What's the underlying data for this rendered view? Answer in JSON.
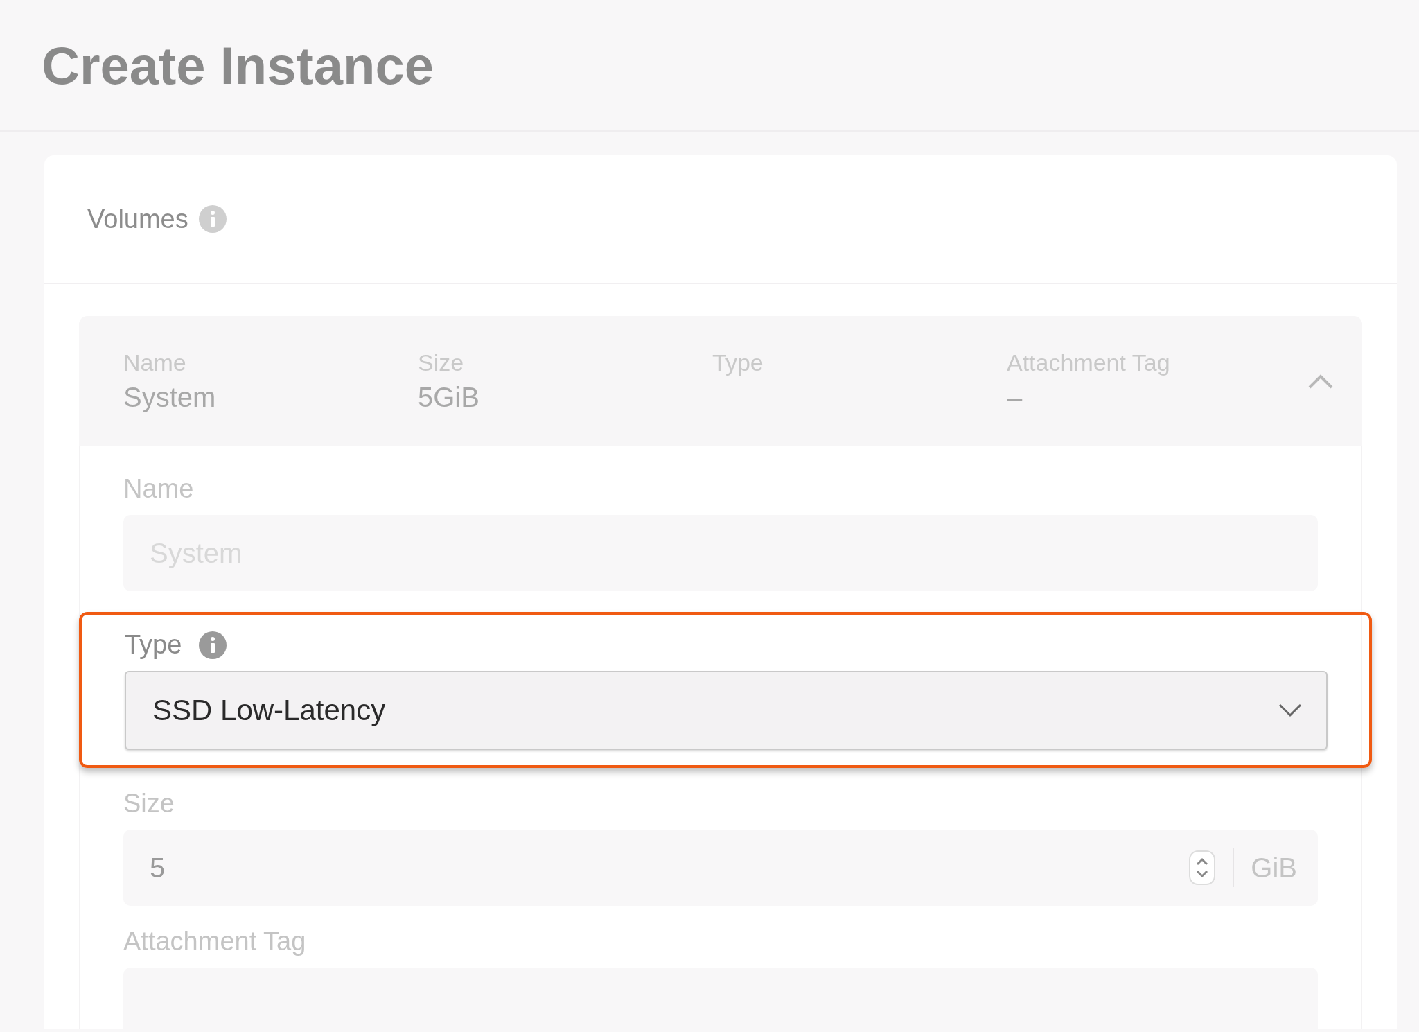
{
  "page": {
    "title": "Create Instance"
  },
  "section": {
    "title": "Volumes"
  },
  "volume": {
    "expanded": true,
    "summary": [
      {
        "label": "Name",
        "value": "System"
      },
      {
        "label": "Size",
        "value": "5GiB"
      },
      {
        "label": "Type"
      },
      {
        "label": "Attachment Tag",
        "value": "–"
      }
    ],
    "fields": [
      {
        "kind": "text",
        "label": "Name",
        "info": false,
        "placeholder": "System",
        "highlighted": false
      },
      {
        "kind": "select",
        "label": "Type",
        "info": true,
        "value": "SSD Low-Latency",
        "highlighted": true
      },
      {
        "kind": "number",
        "label": "Size",
        "info": false,
        "value": "5",
        "unit": "GiB",
        "highlighted": false
      },
      {
        "kind": "text",
        "label": "Attachment Tag",
        "info": false,
        "highlighted": false
      }
    ]
  }
}
